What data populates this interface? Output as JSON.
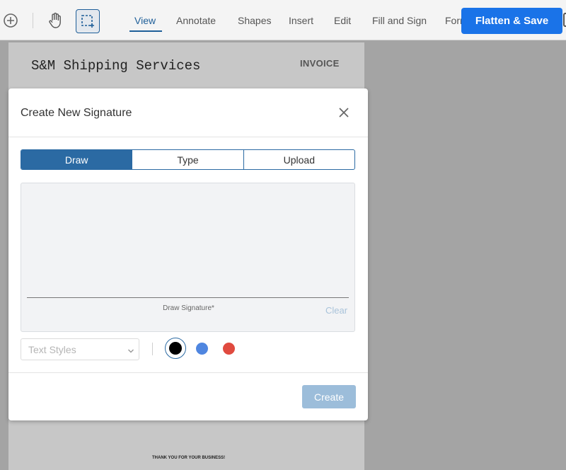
{
  "toolbar": {
    "menus": [
      "View",
      "Annotate",
      "Shapes",
      "Insert",
      "Edit",
      "Fill and Sign",
      "Forms"
    ],
    "active_menu": "View",
    "flatten_label": "Flatten & Save",
    "accent": "#1f5f99",
    "flatten_color": "#1a73e8"
  },
  "document": {
    "company": "S&M Shipping Services",
    "doc_type": "INVOICE",
    "footer": "THANK YOU FOR YOUR BUSINESS!"
  },
  "modal": {
    "title": "Create New Signature",
    "tabs": [
      "Draw",
      "Type",
      "Upload"
    ],
    "active_tab": "Draw",
    "draw_hint": "Draw Signature*",
    "clear_label": "Clear",
    "text_styles_placeholder": "Text Styles",
    "colors": [
      {
        "name": "black",
        "hex": "#000000",
        "selected": true
      },
      {
        "name": "blue",
        "hex": "#4f86e0",
        "selected": false
      },
      {
        "name": "red",
        "hex": "#e04a3f",
        "selected": false
      }
    ],
    "create_label": "Create"
  }
}
